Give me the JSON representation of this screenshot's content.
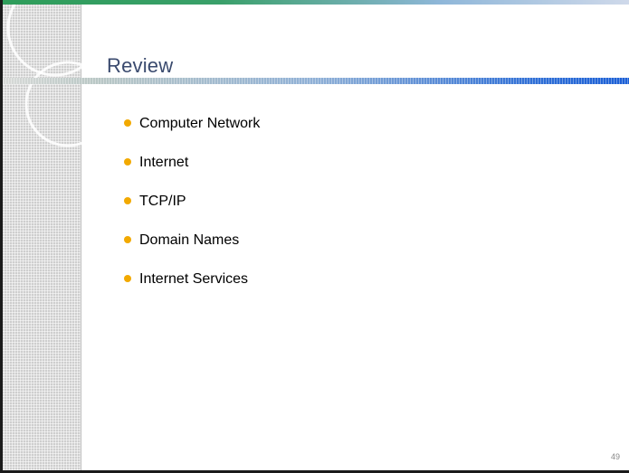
{
  "slide": {
    "title": "Review",
    "bullets": [
      {
        "label": "Computer Network"
      },
      {
        "label": "Internet"
      },
      {
        "label": "TCP/IP"
      },
      {
        "label": "Domain Names"
      },
      {
        "label": "Internet Services"
      }
    ],
    "page_number": "49"
  },
  "colors": {
    "title": "#3a4a6e",
    "bullet": "#f2a900",
    "accent_blue": "#1b5fd6",
    "accent_green": "#2e9d5a"
  }
}
